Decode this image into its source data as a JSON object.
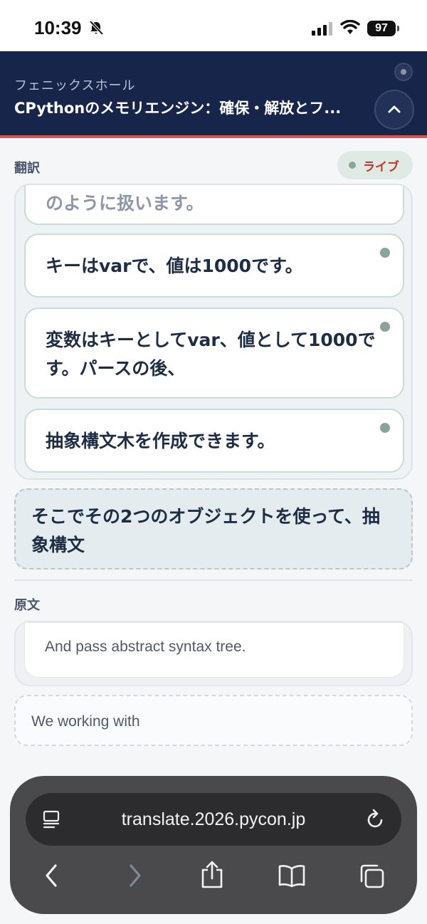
{
  "status_bar": {
    "time": "10:39",
    "battery": "97"
  },
  "header": {
    "venue": "フェニックスホール",
    "title": "CPythonのメモリエンジン：確保・解放とフ..."
  },
  "translation": {
    "section_label": "翻訳",
    "live_label": "ライブ",
    "cards": [
      {
        "text": "のように扱います。"
      },
      {
        "text": "キーはvarで、値は1000です。"
      },
      {
        "text": "変数はキーとしてvar、値として1000です。パースの後、"
      },
      {
        "text": "抽象構文木を作成できます。"
      }
    ],
    "pending_text": "そこでその2つのオブジェクトを使って、抽象構文"
  },
  "original": {
    "section_label": "原文",
    "cards": [
      {
        "text": "And pass abstract syntax tree."
      }
    ],
    "pending_text": "We working with"
  },
  "browser": {
    "url": "translate.2026.pycon.jp"
  },
  "colors": {
    "header_bg": "#18254a",
    "accent_red": "#d9534f",
    "live_text": "#c0392b",
    "live_dot": "#8aa597"
  }
}
